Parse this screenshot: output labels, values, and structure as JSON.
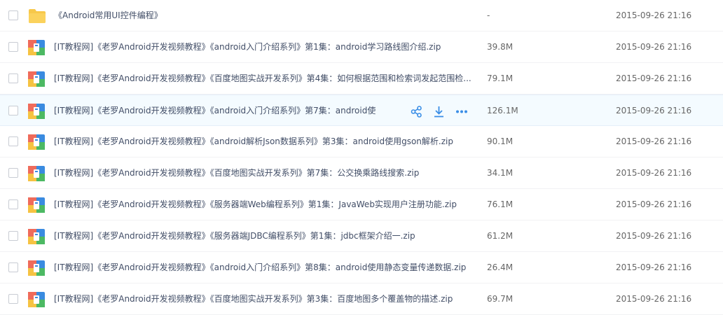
{
  "colors": {
    "folder": "#f7c84a",
    "zip_blue": "#3a8be0",
    "zip_green": "#4cb963",
    "zip_red": "#ef6b5b",
    "zip_yellow": "#f6c342",
    "action": "#3a8ee6"
  },
  "files": [
    {
      "type": "folder",
      "name": "《Android常用UI控件编程》",
      "size": "-",
      "modified": "2015-09-26 21:16"
    },
    {
      "type": "zip",
      "name": "[IT教程网]《老罗Android开发视频教程》《android入门介绍系列》第1集：android学习路线图介绍.zip",
      "size": "39.8M",
      "modified": "2015-09-26 21:16"
    },
    {
      "type": "zip",
      "name": "[IT教程网]《老罗Android开发视频教程》《百度地图实战开发系列》第4集：如何根据范围和检索词发起范围检...",
      "size": "79.1M",
      "modified": "2015-09-26 21:16"
    },
    {
      "type": "zip",
      "name": "[IT教程网]《老罗Android开发视频教程》《android入门介绍系列》第7集：android使...",
      "size": "126.1M",
      "modified": "2015-09-26 21:16",
      "hovered": true
    },
    {
      "type": "zip",
      "name": "[IT教程网]《老罗Android开发视频教程》《android解析Json数据系列》第3集：android使用gson解析.zip",
      "size": "90.1M",
      "modified": "2015-09-26 21:16"
    },
    {
      "type": "zip",
      "name": "[IT教程网]《老罗Android开发视频教程》《百度地图实战开发系列》第7集：公交换乘路线搜索.zip",
      "size": "34.1M",
      "modified": "2015-09-26 21:16"
    },
    {
      "type": "zip",
      "name": "[IT教程网]《老罗Android开发视频教程》《服务器端Web编程系列》第1集：JavaWeb实现用户注册功能.zip",
      "size": "76.1M",
      "modified": "2015-09-26 21:16"
    },
    {
      "type": "zip",
      "name": "[IT教程网]《老罗Android开发视频教程》《服务器端JDBC编程系列》第1集：jdbc框架介绍一.zip",
      "size": "61.2M",
      "modified": "2015-09-26 21:16"
    },
    {
      "type": "zip",
      "name": "[IT教程网]《老罗Android开发视频教程》《android入门介绍系列》第8集：android使用静态变量传递数据.zip",
      "size": "26.4M",
      "modified": "2015-09-26 21:16"
    },
    {
      "type": "zip",
      "name": "[IT教程网]《老罗Android开发视频教程》《百度地图实战开发系列》第3集：百度地图多个覆盖物的描述.zip",
      "size": "69.7M",
      "modified": "2015-09-26 21:16"
    }
  ],
  "hover_actions": [
    {
      "icon": "share-icon"
    },
    {
      "icon": "download-icon"
    },
    {
      "icon": "more-icon"
    }
  ]
}
